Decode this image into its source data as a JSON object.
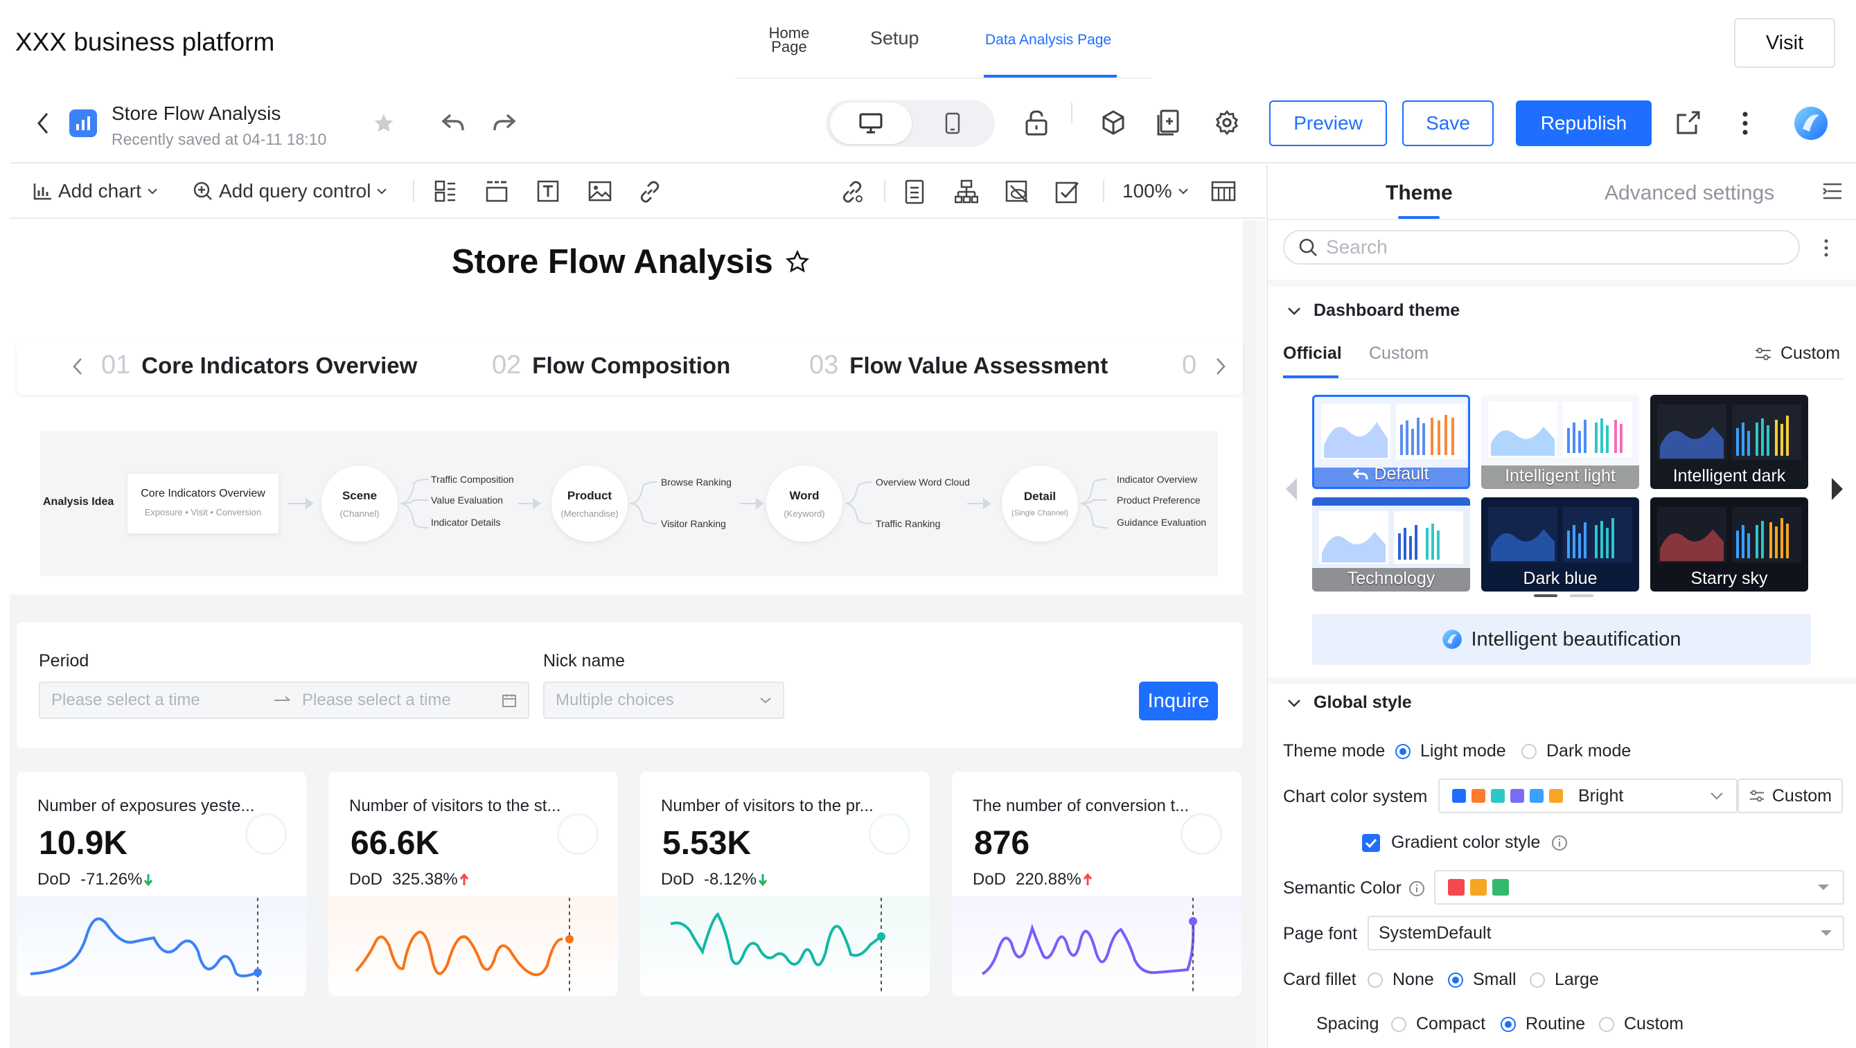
{
  "topbar": {
    "platform_title": "XXX business platform",
    "tabs": [
      {
        "label": "Home Page"
      },
      {
        "label": "Setup"
      },
      {
        "label": "Data Analysis Page"
      }
    ],
    "active_tab": "Data Analysis Page",
    "visit_label": "Visit"
  },
  "editor": {
    "title": "Store Flow Analysis",
    "saved_text": "Recently saved at 04-11 18:10",
    "preview_label": "Preview",
    "save_label": "Save",
    "republish_label": "Republish"
  },
  "toolbar": {
    "add_chart": "Add chart",
    "add_query_control": "Add query control",
    "zoom": "100%"
  },
  "dashboard": {
    "title": "Store Flow Analysis",
    "steps": [
      {
        "num": "01",
        "label": "Core Indicators Overview"
      },
      {
        "num": "02",
        "label": "Flow Composition"
      },
      {
        "num": "03",
        "label": "Flow Value Assessment"
      },
      {
        "num": "0",
        "label": ""
      }
    ],
    "flow": {
      "analysis_label": "Analysis Idea",
      "start_box": {
        "title": "Core Indicators Overview",
        "sub": "Exposure • Visit • Conversion"
      },
      "nodes": [
        {
          "title": "Scene",
          "sub": "(Channel)",
          "items": [
            "Traffic Composition",
            "Value Evaluation",
            "Indicator Details"
          ]
        },
        {
          "title": "Product",
          "sub": "(Merchandise)",
          "items": [
            "Browse Ranking",
            "Visitor Ranking"
          ]
        },
        {
          "title": "Word",
          "sub": "(Keyword)",
          "items": [
            "Overview Word Cloud",
            "Traffic Ranking"
          ]
        },
        {
          "title": "Detail",
          "sub": "(Single Channel)",
          "items": [
            "Indicator Overview",
            "Product Preference",
            "Guidance Evaluation"
          ]
        }
      ]
    },
    "filters": {
      "period_label": "Period",
      "start_placeholder": "Please select a time",
      "end_placeholder": "Please select a time",
      "nick_label": "Nick name",
      "nick_placeholder": "Multiple choices",
      "inquire_label": "Inquire"
    },
    "kpis": [
      {
        "title": "Number of exposures yeste...",
        "value": "10.9K",
        "dod_label": "DoD",
        "dod_value": "-71.26%",
        "trend": "down",
        "color": "#3b82f6"
      },
      {
        "title": "Number of visitors to the st...",
        "value": "66.6K",
        "dod_label": "DoD",
        "dod_value": "325.38%",
        "trend": "up",
        "color": "#f97316"
      },
      {
        "title": "Number of visitors to the pr...",
        "value": "5.53K",
        "dod_label": "DoD",
        "dod_value": "-8.12%",
        "trend": "down",
        "color": "#14b8a6"
      },
      {
        "title": "The number of conversion t...",
        "value": "876",
        "dod_label": "DoD",
        "dod_value": "220.88%",
        "trend": "up",
        "color": "#7c5cfc"
      }
    ]
  },
  "panel": {
    "tabs": [
      "Theme",
      "Advanced settings"
    ],
    "search_placeholder": "Search",
    "dashboard_theme": {
      "title": "Dashboard theme",
      "sub_tabs": [
        "Official",
        "Custom"
      ],
      "custom_link": "Custom",
      "themes": [
        "Default",
        "Intelligent light",
        "Intelligent dark",
        "Technology",
        "Dark blue",
        "Starry sky"
      ],
      "beautify_label": "Intelligent beautification"
    },
    "global_style": {
      "title": "Global style",
      "theme_mode_label": "Theme mode",
      "theme_modes": [
        "Light mode",
        "Dark mode"
      ],
      "chart_color_label": "Chart color system",
      "chart_color_value": "Bright",
      "chart_color_custom": "Custom",
      "gradient_label": "Gradient color style",
      "semantic_label": "Semantic Color",
      "page_font_label": "Page font",
      "page_font_value": "SystemDefault",
      "card_fillet_label": "Card fillet",
      "card_fillets": [
        "None",
        "Small",
        "Large"
      ],
      "spacing_label": "Spacing",
      "spacings": [
        "Compact",
        "Routine",
        "Custom"
      ]
    },
    "colors": {
      "bright": [
        "#1e6fff",
        "#ff7a2f",
        "#2ec7c9",
        "#7b6cf6",
        "#3ba0ff",
        "#f5a623"
      ],
      "semantic": [
        "#f5484e",
        "#f5a623",
        "#32b96d"
      ]
    }
  }
}
